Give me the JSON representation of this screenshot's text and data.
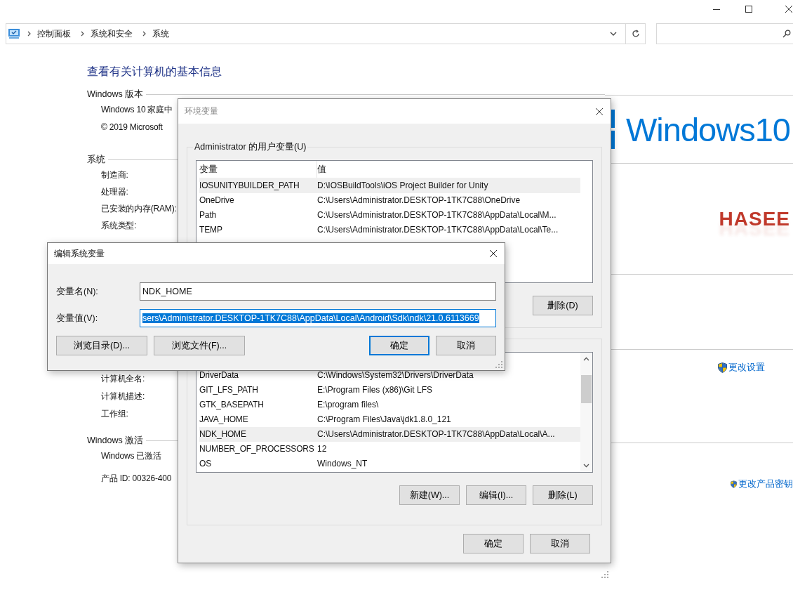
{
  "breadcrumb": [
    "控制面板",
    "系统和安全",
    "系统"
  ],
  "page": {
    "heading": "查看有关计算机的基本信息",
    "sections": [
      {
        "title": "Windows 版本",
        "rows": [
          "Windows 10 家庭中",
          "© 2019 Microsoft"
        ]
      },
      {
        "title": "系统",
        "rows": [
          "制造商:",
          "处理器:",
          "已安装的内存(RAM):",
          "系统类型:"
        ]
      },
      {
        "rows": [
          "计算机全名:",
          "计算机描述:",
          "工作组:"
        ]
      },
      {
        "title": "Windows 激活",
        "rows": [
          "Windows 已激活",
          "产品 ID: 00326-400"
        ]
      }
    ],
    "logo_text": "Windows10",
    "oem_logo": "HASEE",
    "links": [
      "更改设置",
      "更改产品密钥"
    ]
  },
  "env_dialog": {
    "title": "环境变量",
    "active": false,
    "user_group": "Administrator 的用户变量(U)",
    "columns": [
      "变量",
      "值"
    ],
    "user_vars": [
      {
        "name": "IOSUNITYBUILDER_PATH",
        "value": "D:\\IOSBuildTools\\iOS Project Builder for Unity",
        "selected": true
      },
      {
        "name": "OneDrive",
        "value": "C:\\Users\\Administrator.DESKTOP-1TK7C88\\OneDrive",
        "selected": false
      },
      {
        "name": "Path",
        "value": "C:\\Users\\Administrator.DESKTOP-1TK7C88\\AppData\\Local\\M...",
        "selected": false
      },
      {
        "name": "TEMP",
        "value": "C:\\Users\\Administrator.DESKTOP-1TK7C88\\AppData\\Local\\Te...",
        "selected": false
      }
    ],
    "user_buttons": [
      "删除(D)"
    ],
    "system_vars": [
      {
        "name": "DriverData",
        "value": "C:\\Windows\\System32\\Drivers\\DriverData",
        "selected": false
      },
      {
        "name": "GIT_LFS_PATH",
        "value": "E:\\Program Files (x86)\\Git LFS",
        "selected": false
      },
      {
        "name": "GTK_BASEPATH",
        "value": "E:\\program files\\",
        "selected": false
      },
      {
        "name": "JAVA_HOME",
        "value": "C:\\Program Files\\Java\\jdk1.8.0_121",
        "selected": false
      },
      {
        "name": "NDK_HOME",
        "value": "C:\\Users\\Administrator.DESKTOP-1TK7C88\\AppData\\Local\\A...",
        "selected": true
      },
      {
        "name": "NUMBER_OF_PROCESSORS",
        "value": "12",
        "selected": false
      },
      {
        "name": "OS",
        "value": "Windows_NT",
        "selected": false
      }
    ],
    "system_buttons": [
      "新建(W)...",
      "编辑(I)...",
      "删除(L)"
    ],
    "footer_buttons": [
      {
        "label": "确定",
        "default": false
      },
      {
        "label": "取消",
        "default": false
      }
    ]
  },
  "edit_dialog": {
    "title": "编辑系统变量",
    "active": true,
    "fields": [
      {
        "label": "变量名(N):",
        "value": "NDK_HOME",
        "selected_text": false
      },
      {
        "label": "变量值(V):",
        "value": "sers\\Administrator.DESKTOP-1TK7C88\\AppData\\Local\\Android\\Sdk\\ndk\\21.0.6113669",
        "selected_text": true
      }
    ],
    "left_buttons": [
      "浏览目录(D)...",
      "浏览文件(F)..."
    ],
    "right_buttons": [
      {
        "label": "确定",
        "default": true
      },
      {
        "label": "取消",
        "default": false
      }
    ]
  }
}
